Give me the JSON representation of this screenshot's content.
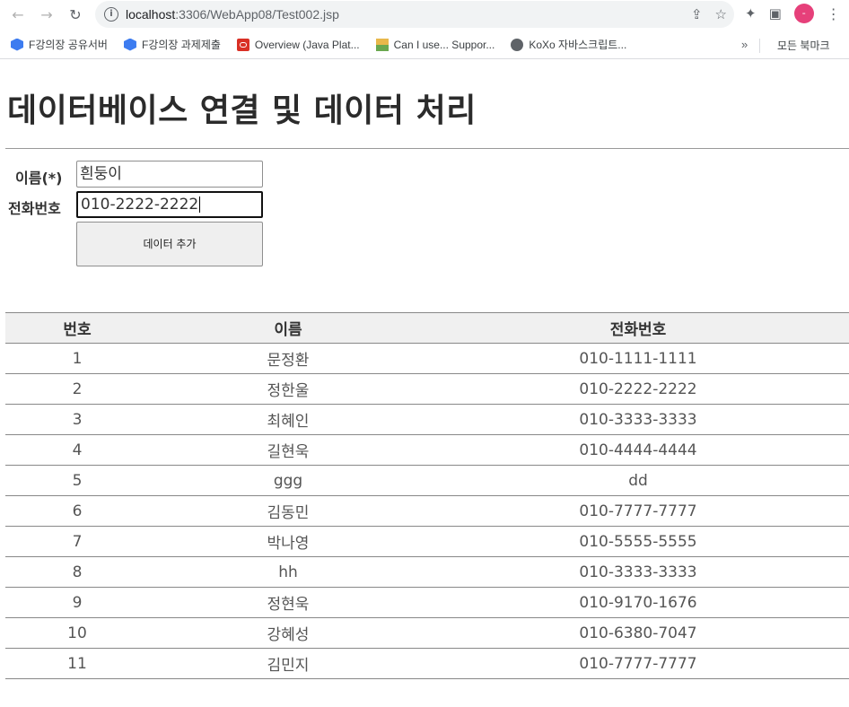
{
  "browser": {
    "url_host": "localhost",
    "url_path": ":3306/WebApp08/Test002.jsp",
    "avatar_letter": "-"
  },
  "bookmarks": {
    "items": [
      {
        "label": "F강의장 공유서버",
        "icon": "hexagon-icon"
      },
      {
        "label": "F강의장 과제제출",
        "icon": "hexagon-icon"
      },
      {
        "label": "Overview (Java Plat...",
        "icon": "oracle-icon"
      },
      {
        "label": "Can I use... Suppor...",
        "icon": "chart-icon"
      },
      {
        "label": "KoXo 자바스크립트...",
        "icon": "globe-icon"
      }
    ],
    "more": "»",
    "all_label": "모든 북마크"
  },
  "page": {
    "title": "데이터베이스 연결 및 데이터 처리"
  },
  "form": {
    "name_label": "이름(*)",
    "name_value": "흰둥이",
    "tel_label": "전화번호",
    "tel_value": "010-2222-2222",
    "submit_label": "데이터 추가"
  },
  "table": {
    "headers": [
      "번호",
      "이름",
      "전화번호"
    ],
    "rows": [
      [
        "1",
        "문정환",
        "010-1111-1111"
      ],
      [
        "2",
        "정한울",
        "010-2222-2222"
      ],
      [
        "3",
        "최혜인",
        "010-3333-3333"
      ],
      [
        "4",
        "길현욱",
        "010-4444-4444"
      ],
      [
        "5",
        "ggg",
        "dd"
      ],
      [
        "6",
        "김동민",
        "010-7777-7777"
      ],
      [
        "7",
        "박나영",
        "010-5555-5555"
      ],
      [
        "8",
        "hh",
        "010-3333-3333"
      ],
      [
        "9",
        "정현욱",
        "010-9170-1676"
      ],
      [
        "10",
        "강혜성",
        "010-6380-7047"
      ],
      [
        "11",
        "김민지",
        "010-7777-7777"
      ]
    ]
  }
}
